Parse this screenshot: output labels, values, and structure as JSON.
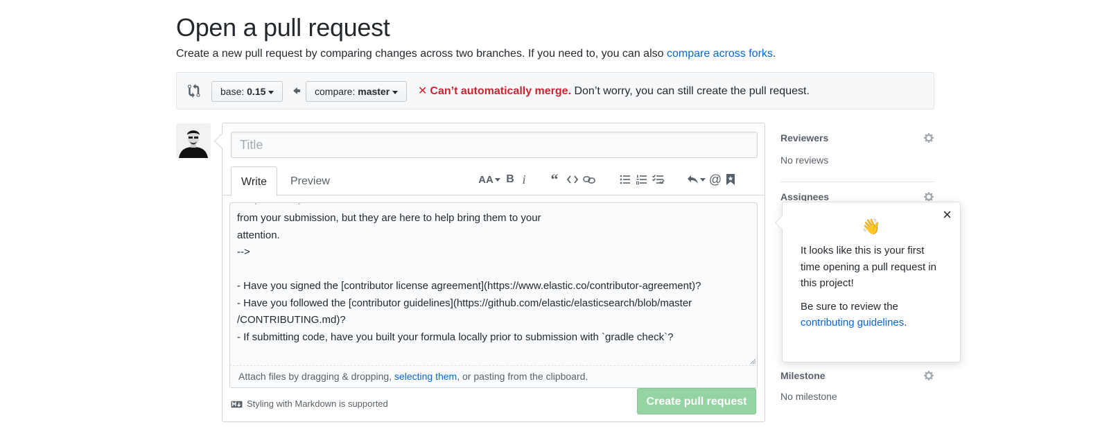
{
  "header": {
    "title": "Open a pull request",
    "subtitle_text": "Create a new pull request by comparing changes across two branches. If you need to, you can also ",
    "subtitle_link": "compare across forks",
    "subtitle_end": "."
  },
  "range": {
    "base_label": "base:",
    "base_value": "0.15",
    "compare_label": "compare:",
    "compare_value": "master",
    "merge_x": "✕",
    "merge_status": "Can’t automatically merge.",
    "merge_note": " Don’t worry, you can still create the pull request."
  },
  "form": {
    "title_placeholder": "Title",
    "tab_write": "Write",
    "tab_preview": "Preview",
    "body_lines": [
      "from your submission, but they are here to help bring them to your",
      "attention.",
      "-->",
      "",
      "- Have you signed the [contributor license agreement](https://www.elastic.co/contributor-agreement)?",
      "- Have you followed the [contributor guidelines](https://github.com/elastic/elasticsearch/blob/master",
      "/CONTRIBUTING.md)?",
      "- If submitting code, have you built your formula locally prior to submission with `gradle check`?"
    ],
    "attach_text_1": "Attach files by dragging & dropping, ",
    "attach_link": "selecting them",
    "attach_text_2": ", or pasting from the clipboard.",
    "markdown_note": "Styling with Markdown is supported",
    "submit_label": "Create pull request"
  },
  "toolbar": {
    "icons": [
      "text-size-icon",
      "bold-icon",
      "italic-icon",
      "quote-icon",
      "code-icon",
      "link-icon",
      "unordered-list-icon",
      "ordered-list-icon",
      "task-list-icon",
      "reply-icon",
      "mention-icon",
      "bookmark-icon"
    ]
  },
  "sidebar": {
    "reviewers_heading": "Reviewers",
    "reviewers_value": "No reviews",
    "assignees_heading": "Assignees",
    "milestone_heading": "Milestone",
    "milestone_value": "No milestone"
  },
  "popover": {
    "close": "×",
    "wave": "👋",
    "message": "It looks like this is your first time opening a pull request in this project!",
    "review_text": "Be sure to review the ",
    "review_link": "contributing guidelines",
    "review_end": "."
  },
  "colors": {
    "link": "#0366d6",
    "error": "#cb2431",
    "submit_disabled": "#94d3a2"
  }
}
